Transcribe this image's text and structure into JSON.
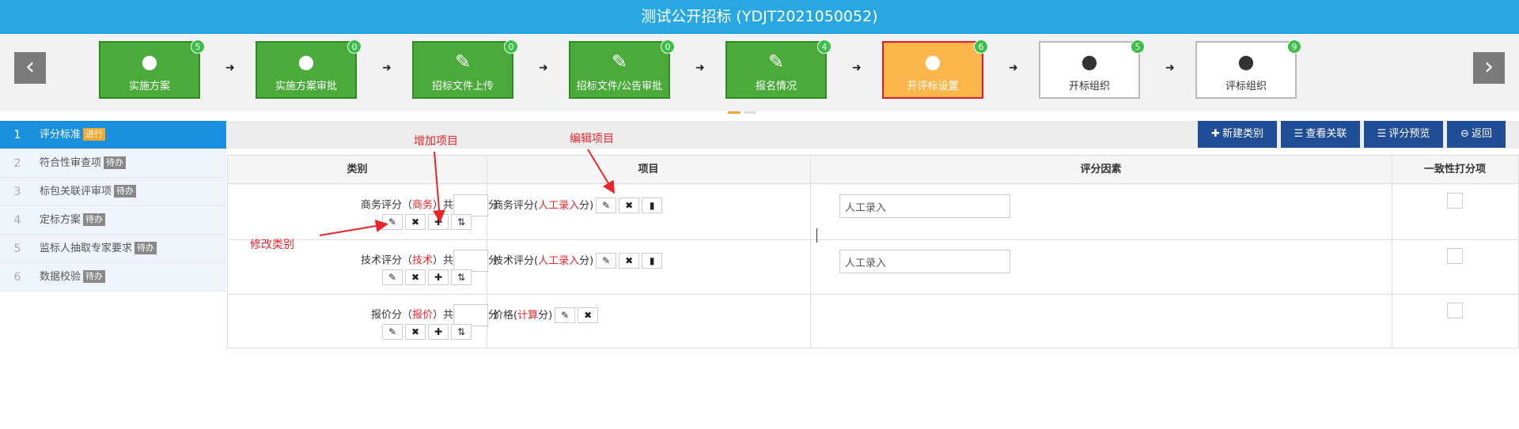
{
  "window": {
    "title": "测试公开招标 (YDJT2021050052)"
  },
  "steps": [
    {
      "label": "实施方案",
      "count": "5",
      "icon": "user-icon",
      "state": "done"
    },
    {
      "label": "实施方案审批",
      "count": "0",
      "icon": "user-icon",
      "state": "done"
    },
    {
      "label": "招标文件上传",
      "count": "0",
      "icon": "pencil-icon",
      "state": "done"
    },
    {
      "label": "招标文件/公告审批",
      "count": "0",
      "icon": "pencil-icon",
      "state": "done"
    },
    {
      "label": "报名情况",
      "count": "4",
      "icon": "pencil-icon",
      "state": "done"
    },
    {
      "label": "开评标设置",
      "count": "6",
      "icon": "user-icon",
      "state": "current"
    },
    {
      "label": "开标组织",
      "count": "5",
      "icon": "user-icon",
      "state": "pending"
    },
    {
      "label": "评标组织",
      "count": "9",
      "icon": "user-icon",
      "state": "pending"
    }
  ],
  "sidebar": {
    "items": [
      {
        "num": "1",
        "label": "评分标准",
        "tag": "进行"
      },
      {
        "num": "2",
        "label": "符合性审查项",
        "tag": "待办"
      },
      {
        "num": "3",
        "label": "标包关联评审项",
        "tag": "待办"
      },
      {
        "num": "4",
        "label": "定标方案",
        "tag": "待办"
      },
      {
        "num": "5",
        "label": "监标人抽取专家要求",
        "tag": "待办"
      },
      {
        "num": "6",
        "label": "数据校验",
        "tag": "待办"
      }
    ]
  },
  "toolbar": {
    "new_category": "新建类别",
    "view_relation": "查看关联",
    "score_preview": "评分预览",
    "back": "返回"
  },
  "table": {
    "headers": {
      "category": "类别",
      "item": "项目",
      "factor": "评分因素",
      "consistency": "一致性打分项"
    },
    "rows": [
      {
        "cat_prefix": "商务评分（",
        "cat_tag": "商务",
        "cat_suffix": "）共",
        "unit": "分",
        "item_prefix": "商务评分(",
        "item_method": "人工录入",
        "item_suffix": "分)",
        "factor_value": "人工录入"
      },
      {
        "cat_prefix": "技术评分（",
        "cat_tag": "技术",
        "cat_suffix": "）共",
        "unit": "分",
        "item_prefix": "技术评分(",
        "item_method": "人工录入",
        "item_suffix": "分)",
        "factor_value": "人工录入"
      },
      {
        "cat_prefix": "报价分（",
        "cat_tag": "报价",
        "cat_suffix": "）共",
        "unit": "分",
        "item_prefix": "价格(",
        "item_method": "计算",
        "item_suffix": "分)",
        "factor_value": ""
      }
    ]
  },
  "annotations": {
    "add_item": "增加项目",
    "edit_item": "编辑项目",
    "edit_category": "修改类别"
  },
  "colors": {
    "title_bar": "#29a7e1",
    "step_done": "#4aab3a",
    "step_current": "#fcb64b",
    "toolbar_button": "#1f4e96",
    "annotation": "#e8252d"
  }
}
